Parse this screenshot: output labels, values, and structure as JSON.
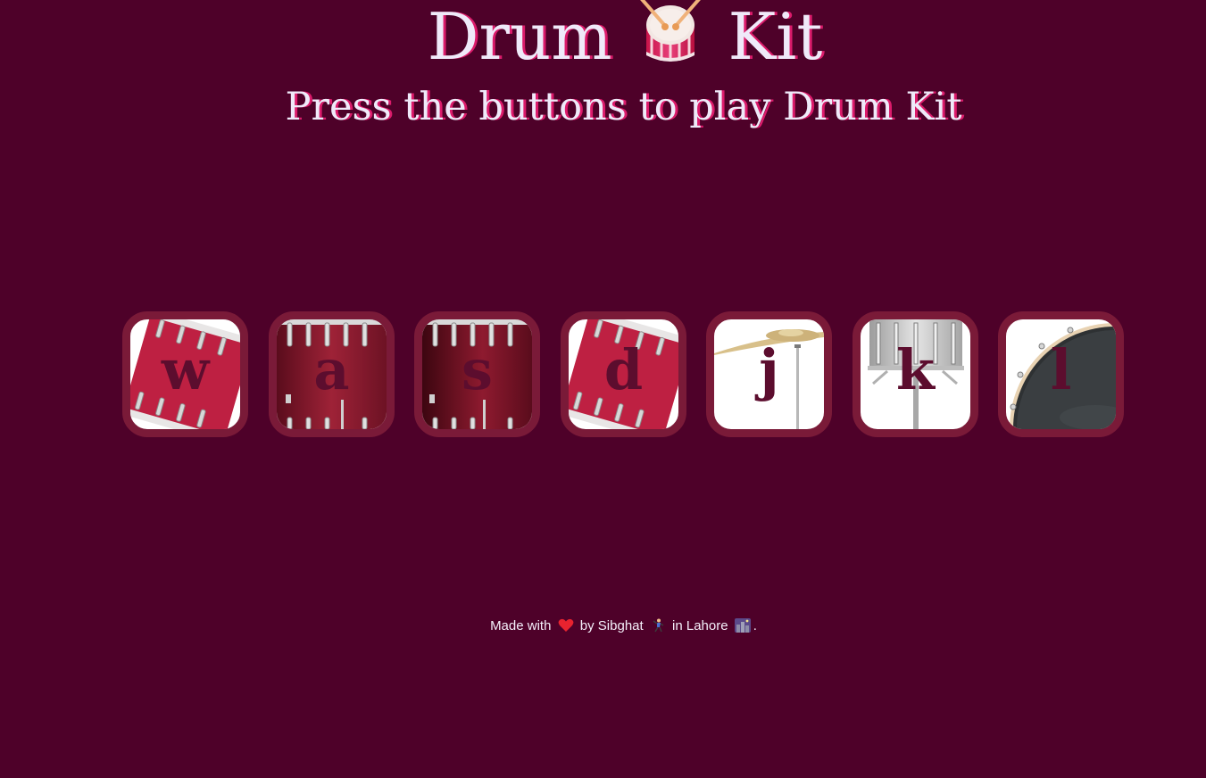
{
  "header": {
    "title_left": "Drum",
    "title_icon": "drum-emoji-icon",
    "title_right": "Kit",
    "subtitle": "Press the buttons to play Drum Kit"
  },
  "drums": [
    {
      "key": "w",
      "art": "tom-tilted"
    },
    {
      "key": "a",
      "art": "tom-front"
    },
    {
      "key": "s",
      "art": "tom-front-dark"
    },
    {
      "key": "d",
      "art": "tom-tilted"
    },
    {
      "key": "j",
      "art": "crash-cymbal"
    },
    {
      "key": "k",
      "art": "snare"
    },
    {
      "key": "l",
      "art": "kick-drum"
    }
  ],
  "footer": {
    "made_with": "Made with",
    "by": "by Sibghat",
    "in": "in Lahore",
    "end": ".",
    "icons": [
      "red-heart-icon",
      "dancing-man-icon",
      "night-city-icon"
    ]
  },
  "colors": {
    "background": "#4e0129",
    "title_text": "#efeaf9",
    "title_shadow": "#db1b6b",
    "button_border": "#7a1a38",
    "key_letter": "#5c0d2e"
  }
}
